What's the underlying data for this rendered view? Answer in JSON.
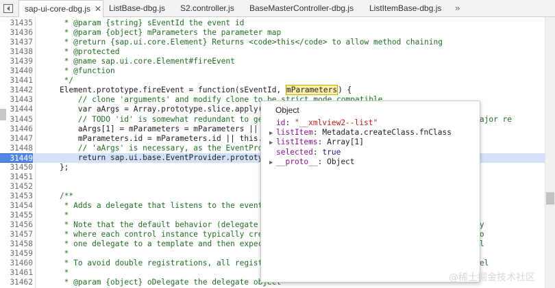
{
  "tabs": [
    {
      "label": "sap-ui-core-dbg.js",
      "close": "✕"
    },
    {
      "label": "ListBase-dbg.js"
    },
    {
      "label": "S2.controller.js"
    },
    {
      "label": "BaseMasterController-dbg.js"
    },
    {
      "label": "ListItemBase-dbg.js"
    }
  ],
  "tab_overflow": "»",
  "lines": [
    {
      "n": "31435",
      "t": "     * @param {string} sEventId the event id"
    },
    {
      "n": "31436",
      "t": "     * @param {object} mParameters the parameter map"
    },
    {
      "n": "31437",
      "t": "     * @return {sap.ui.core.Element} Returns <code>this</code> to allow method chaining"
    },
    {
      "n": "31438",
      "t": "     * @protected"
    },
    {
      "n": "31439",
      "t": "     * @name sap.ui.core.Element#fireEvent"
    },
    {
      "n": "31440",
      "t": "     * @function"
    },
    {
      "n": "31441",
      "t": "     */"
    },
    {
      "n": "31442",
      "t": "    Element.prototype.fireEvent = function(sEventId, ",
      "tok": "mParameters",
      "after": ") {"
    },
    {
      "n": "31443",
      "t": "        // clone 'arguments' and modify clone to be strict mode compatible"
    },
    {
      "n": "31444",
      "t": "        var aArgs = Array.prototype.slice.apply(a"
    },
    {
      "n": "31445",
      "t": "        // TODO 'id' is somewhat redundant to get                                        next major re"
    },
    {
      "n": "31446",
      "t": "        aArgs[1] = mParameters = mParameters || {"
    },
    {
      "n": "31447",
      "t": "        mParameters.id = mParameters.id || this.g"
    },
    {
      "n": "31448",
      "t": "        // 'aArgs' is necessary, as the EventProvi"
    },
    {
      "n": "31449",
      "t": "        return sap.ui.base.EventProvider.prototyp"
    },
    {
      "n": "31450",
      "t": "    };"
    },
    {
      "n": "31451",
      "t": ""
    },
    {
      "n": "31452",
      "t": ""
    },
    {
      "n": "31453",
      "t": "    /**"
    },
    {
      "n": "31454",
      "t": "     * Adds a delegate that listens to the events"
    },
    {
      "n": "31455",
      "t": "     *"
    },
    {
      "n": "31456",
      "t": "     * Note that the default behavior (delegate a                                  d) is usually"
    },
    {
      "n": "31457",
      "t": "     * where each control instance typically crea                                  to applicatio"
    },
    {
      "n": "31458",
      "t": "     * one delegate to a template and then expect                                  all cloned el"
    },
    {
      "n": "31459",
      "t": "     *"
    },
    {
      "n": "31460",
      "t": "     * To avoid double registrations, all registr                                  d then the del"
    },
    {
      "n": "31461",
      "t": "     *"
    },
    {
      "n": "31462",
      "t": "     * @param {object} oDelegate the delegate object"
    }
  ],
  "popover": {
    "title": "Object",
    "props": [
      {
        "key": "id",
        "val": "\"__xmlview2--list\"",
        "kind": "str",
        "expand": false
      },
      {
        "key": "listItem",
        "val": "Metadata.createClass.fnClass",
        "kind": "obj",
        "expand": true
      },
      {
        "key": "listItems",
        "val": "Array[1]",
        "kind": "obj",
        "expand": true
      },
      {
        "key": "selected",
        "val": "true",
        "kind": "bool",
        "expand": false
      },
      {
        "key": "__proto__",
        "val": "Object",
        "kind": "obj",
        "expand": true
      }
    ]
  },
  "watermark": "@稀土掘金技术社区",
  "colors": {
    "highlight_line": "#5387e5",
    "comment": "#236e25",
    "keyword": "#a90d91"
  }
}
